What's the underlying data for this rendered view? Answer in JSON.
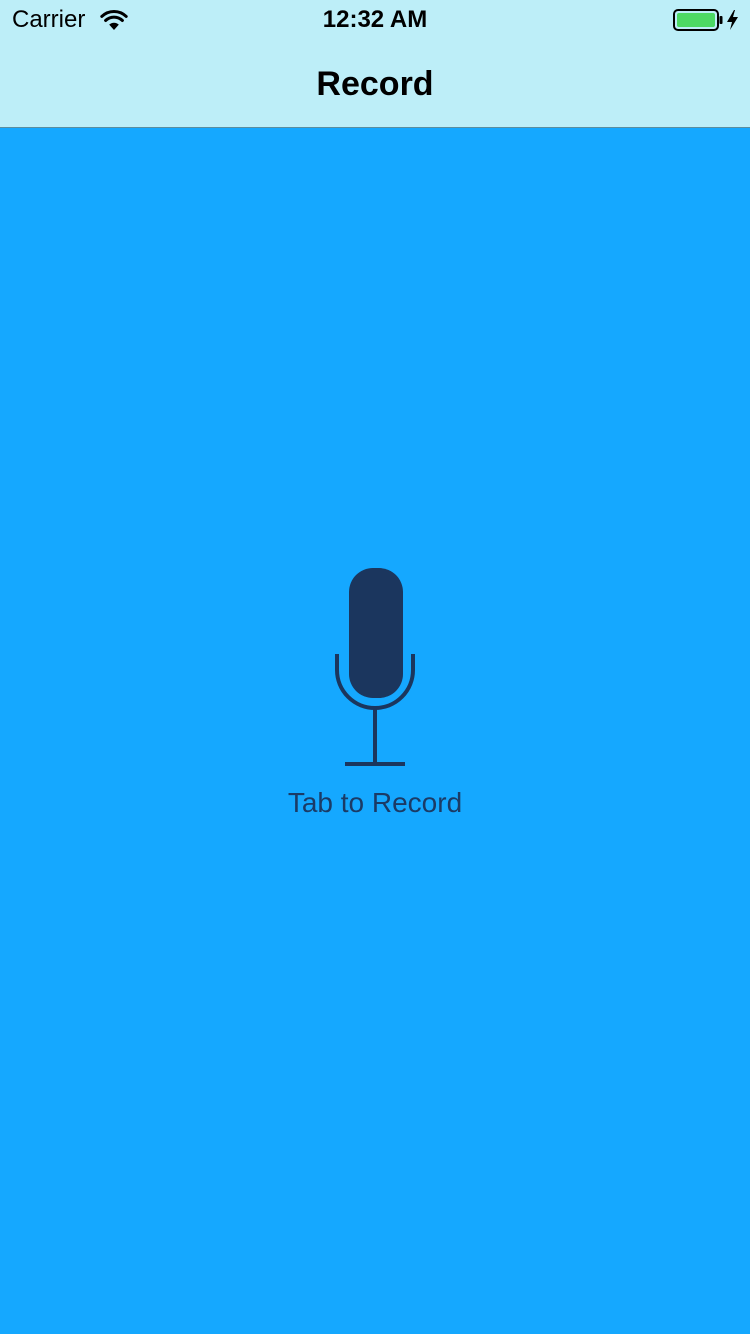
{
  "status_bar": {
    "carrier": "Carrier",
    "time": "12:32 AM",
    "wifi_icon": "wifi-icon",
    "battery_icon": "battery-charging-icon"
  },
  "nav": {
    "title": "Record"
  },
  "main": {
    "mic_icon": "microphone-icon",
    "record_label": "Tab to Record"
  },
  "colors": {
    "background": "#15a8ff",
    "nav_background": "#bdeef8",
    "mic": "#1b365e",
    "battery_fill": "#4cd964"
  }
}
